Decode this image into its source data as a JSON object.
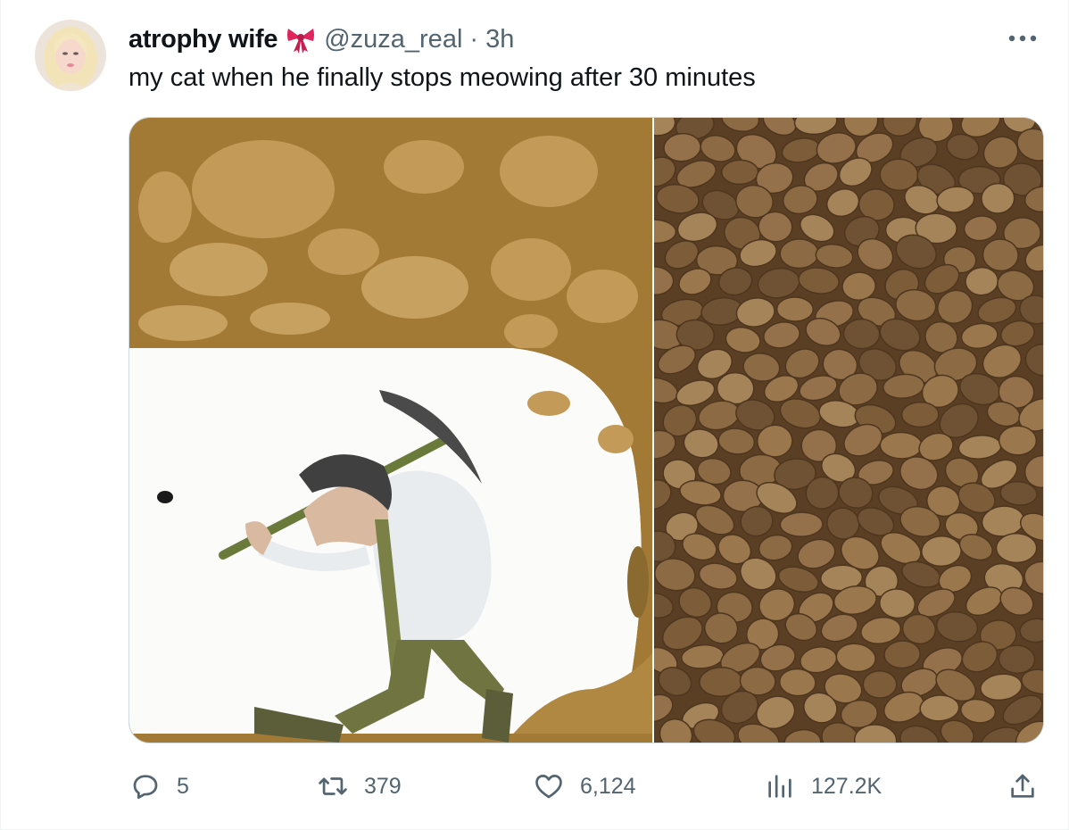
{
  "author": {
    "display_name": "atrophy wife",
    "handle": "@zuza_real",
    "separator": "·",
    "time": "3h",
    "emoji_icon": "ribbon-bow-icon"
  },
  "tweet": {
    "text": "my cat when he finally stops meowing after 30 minutes"
  },
  "media": {
    "left_image": "man-with-pickaxe-tunnel-cartoon",
    "right_image": "dry-cat-food-kibble"
  },
  "actions": {
    "reply_count": "5",
    "retweet_count": "379",
    "like_count": "6,124",
    "view_count": "127.2K"
  },
  "colors": {
    "secondary_text": "#536471",
    "border": "#cfd9de",
    "bow_red": "#e0245e"
  }
}
